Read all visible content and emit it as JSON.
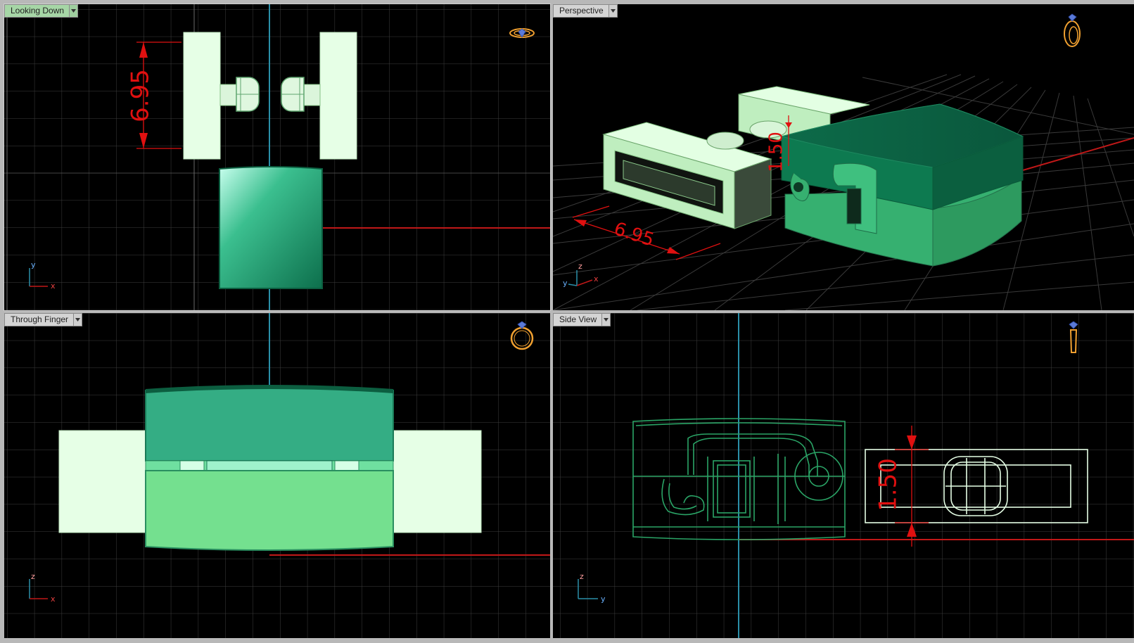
{
  "viewports": {
    "top_left": {
      "label": "Looking Down",
      "active": true,
      "axes": [
        "y",
        "x"
      ],
      "dimension": "6.95"
    },
    "top_right": {
      "label": "Perspective",
      "active": false,
      "axes": [
        "z",
        "y",
        "x"
      ],
      "dimensions": [
        "6.95",
        "1.50"
      ]
    },
    "bottom_left": {
      "label": "Through Finger",
      "active": false,
      "axes": [
        "z",
        "x"
      ]
    },
    "bottom_right": {
      "label": "Side View",
      "active": false,
      "axes": [
        "z",
        "y"
      ],
      "dimension": "1.50"
    }
  },
  "colors": {
    "background": "#000000",
    "grid": "#404040",
    "model_dark": "#0e7a54",
    "model_mid": "#39b083",
    "model_light": "#e6ffe6",
    "dimension": "#e01010",
    "axis_red": "#c01818",
    "axis_blue": "#1f8fa8",
    "gem_icon": "#f0a030"
  },
  "icons": {
    "top_left": "ring-top-icon",
    "top_right": "ring-perspective-icon",
    "bottom_left": "ring-front-icon",
    "bottom_right": "ring-side-icon"
  }
}
